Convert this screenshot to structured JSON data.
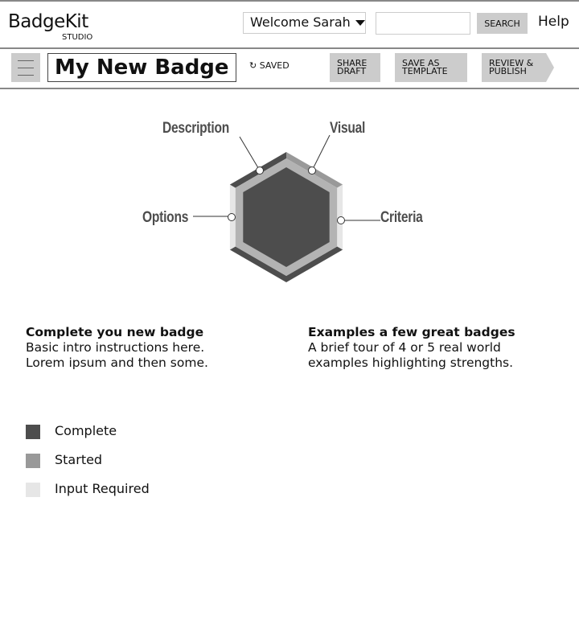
{
  "header": {
    "logo": "BadgeKit",
    "logo_sub": "STUDIO",
    "welcome": "Welcome Sarah",
    "search_value": "",
    "search_label": "SEARCH",
    "help": "Help"
  },
  "toolbar": {
    "menu_icon": "hamburger-icon",
    "badge_title": "My New Badge",
    "saved_icon": "refresh-icon",
    "saved": "SAVED",
    "share": [
      "SHARE",
      "DRAFT"
    ],
    "template": [
      "SAVE AS",
      "TEMPLATE"
    ],
    "publish": [
      "REVIEW &",
      "PUBLISH"
    ]
  },
  "badge": {
    "sections": [
      {
        "label": "Description",
        "status": "complete"
      },
      {
        "label": "Visual",
        "status": "started"
      },
      {
        "label": "Criteria",
        "status": "input_required"
      },
      {
        "label": "Options",
        "status": "input_required"
      }
    ]
  },
  "colors": {
    "complete": "#4d4d4d",
    "started": "#999999",
    "input_required": "#e6e6e6",
    "ring": "#b3b3b3"
  },
  "intro": {
    "title": "Complete you new badge",
    "lines": [
      "Basic intro instructions here.",
      "Lorem ipsum and then some."
    ]
  },
  "examples": {
    "title": "Examples a few great badges",
    "lines": [
      "A brief tour of 4 or 5 real world",
      "examples highlighting strengths."
    ]
  },
  "legend": [
    {
      "key": "complete",
      "label": "Complete"
    },
    {
      "key": "started",
      "label": "Started"
    },
    {
      "key": "input_required",
      "label": "Input Required"
    }
  ]
}
